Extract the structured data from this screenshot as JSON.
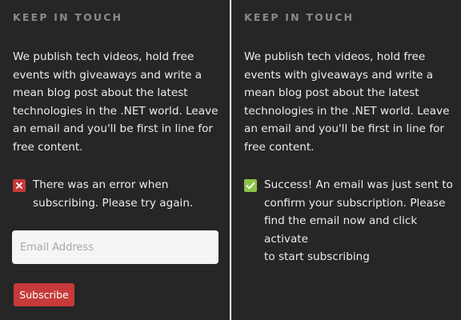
{
  "left_panel": {
    "heading": "KEEP IN TOUCH",
    "intro_lines": [
      "We publish tech videos, hold free",
      "events with giveaways and write a",
      "mean blog post about the latest",
      "technologies in the .NET world. Leave",
      "an email and you'll be first in line for",
      "free content."
    ],
    "status": {
      "type": "error",
      "icon": "close-icon",
      "color": "#c63a3a",
      "lines": [
        "There was an error when",
        "subscribing. Please try again."
      ]
    },
    "email_input": {
      "placeholder": "Email Address",
      "value": ""
    },
    "subscribe_label": "Subscribe",
    "accent_color": "#c63a3a"
  },
  "right_panel": {
    "heading": "KEEP IN TOUCH",
    "intro_lines": [
      "We publish tech videos, hold free",
      "events with giveaways and write a",
      "mean blog post about the latest",
      "technologies in the .NET world. Leave",
      "an email and you'll be first in line for",
      "free content."
    ],
    "status": {
      "type": "success",
      "icon": "checkmark-icon",
      "color": "#8bc34a",
      "lines": [
        "Success! An email was just sent to",
        "confirm your subscription. Please",
        "find the email now and click activate",
        "to start subscribing"
      ]
    }
  },
  "colors": {
    "panel_background": "#262626",
    "heading_text": "#8a8a8a",
    "body_text": "#ececec"
  }
}
